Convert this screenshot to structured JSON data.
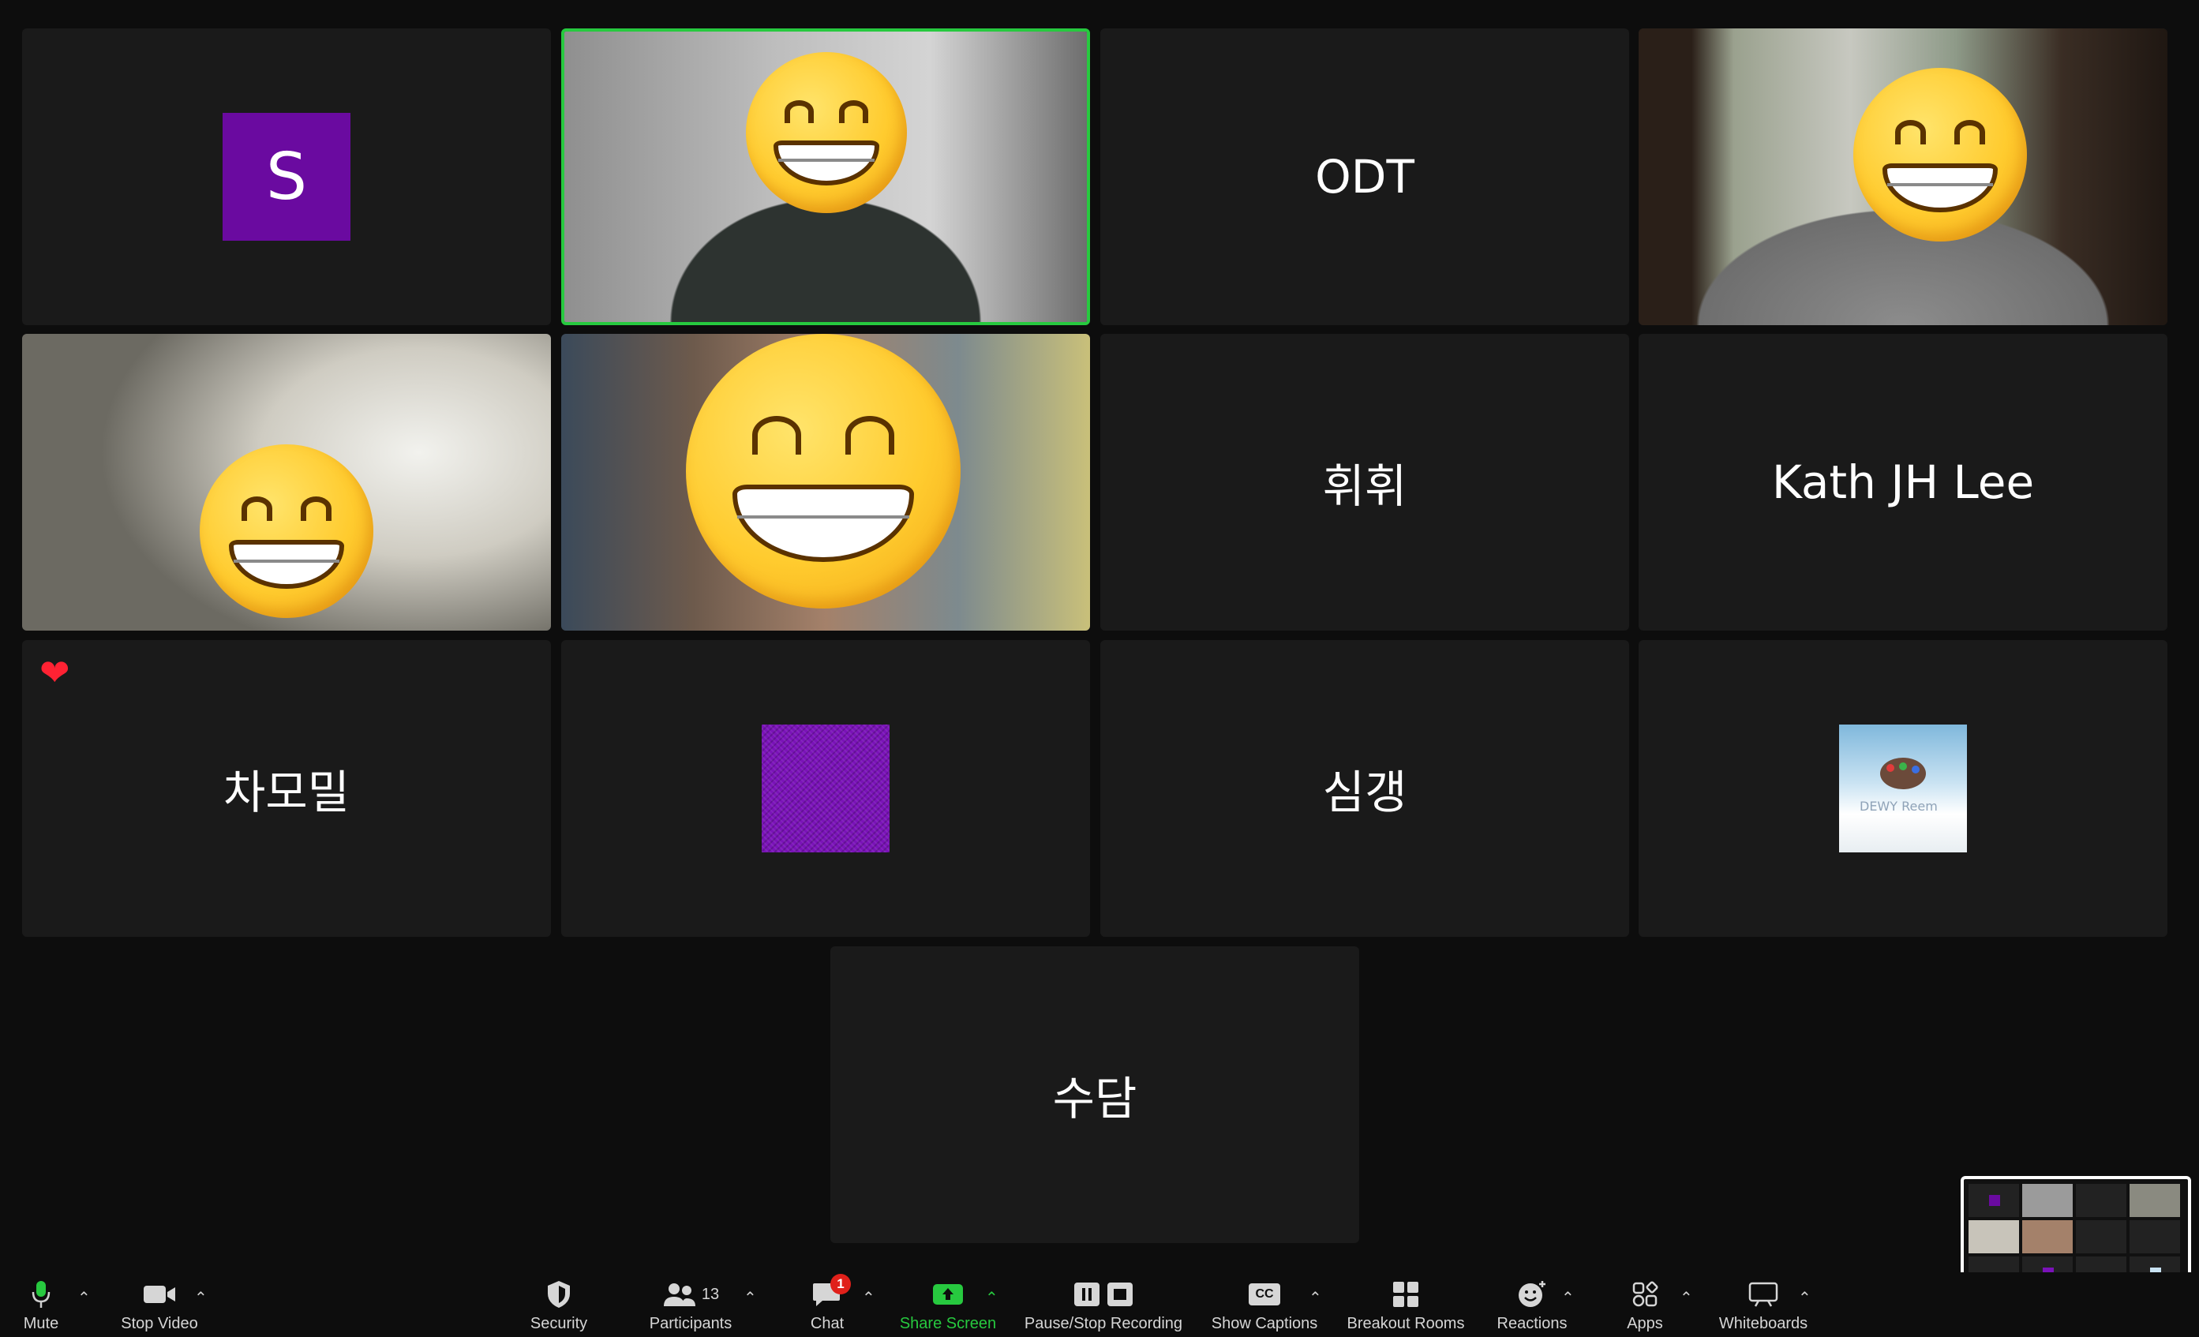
{
  "colors": {
    "accent_green": "#27c93f",
    "badge_red": "#e0201a",
    "avatar_purple": "#6a0aa0"
  },
  "tiles": [
    {
      "kind": "avatar",
      "avatar_letter": "S"
    },
    {
      "kind": "video",
      "speaking": true
    },
    {
      "kind": "name",
      "name": "ODT"
    },
    {
      "kind": "video"
    },
    {
      "kind": "video"
    },
    {
      "kind": "video"
    },
    {
      "kind": "name",
      "name": "휘휘"
    },
    {
      "kind": "name",
      "name": "Kath JH Lee"
    },
    {
      "kind": "name",
      "name": "차모밀",
      "reaction": "heart-icon"
    },
    {
      "kind": "avatar-image"
    },
    {
      "kind": "name",
      "name": "심갱"
    },
    {
      "kind": "avatar-image",
      "image_caption": "DEWY Reem"
    },
    {
      "kind": "name",
      "name": "수담"
    }
  ],
  "toolbar": {
    "mute_label": "Mute",
    "stop_video_label": "Stop Video",
    "security_label": "Security",
    "participants_label": "Participants",
    "participants_count": "13",
    "chat_label": "Chat",
    "chat_badge": "1",
    "share_screen_label": "Share Screen",
    "recording_label": "Pause/Stop Recording",
    "captions_label": "Show Captions",
    "captions_icon_text": "CC",
    "breakout_label": "Breakout Rooms",
    "reactions_label": "Reactions",
    "apps_label": "Apps",
    "whiteboards_label": "Whiteboards"
  }
}
